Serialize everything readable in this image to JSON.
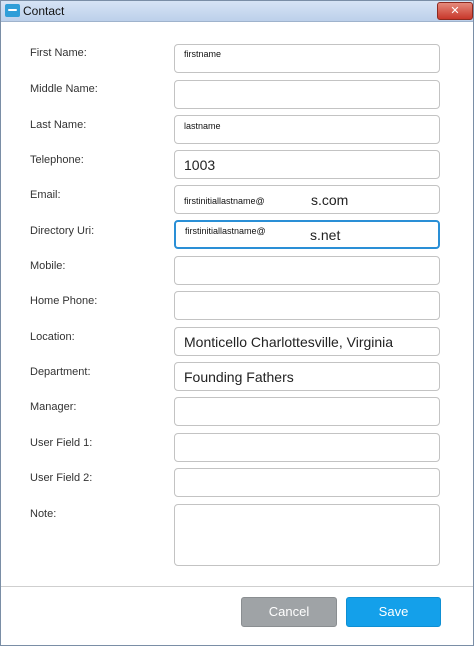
{
  "window": {
    "title": "Contact",
    "close_glyph": "✕"
  },
  "fields": [
    {
      "label": "First Name:",
      "value": "firstname"
    },
    {
      "label": "Middle Name:",
      "value": ""
    },
    {
      "label": "Last Name:",
      "value": "lastname"
    },
    {
      "label": "Telephone:",
      "value": "1003"
    },
    {
      "label": "Email:",
      "value_left": "firstinitiallastname@",
      "value_right": "s.com"
    },
    {
      "label": "Directory Uri:",
      "value_left": "firstinitiallastname@",
      "value_right": "s.net"
    },
    {
      "label": "Mobile:",
      "value": ""
    },
    {
      "label": "Home Phone:",
      "value": ""
    },
    {
      "label": "Location:",
      "value": "Monticello Charlottesville, Virginia"
    },
    {
      "label": "Department:",
      "value": "Founding Fathers"
    },
    {
      "label": "Manager:",
      "value": ""
    },
    {
      "label": "User Field 1:",
      "value": ""
    },
    {
      "label": "User Field 2:",
      "value": ""
    },
    {
      "label": "Note:",
      "value": ""
    }
  ],
  "buttons": {
    "cancel": "Cancel",
    "save": "Save"
  },
  "colors": {
    "accent": "#14a0ea",
    "focus_border": "#2a8fd6",
    "cancel_gray": "#9fa3a6"
  }
}
